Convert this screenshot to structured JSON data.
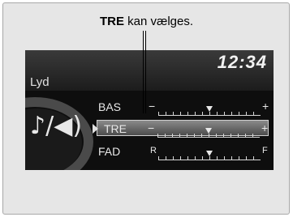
{
  "callout": {
    "bold": "TRE",
    "rest": " kan vælges."
  },
  "screen": {
    "clock": "12:34",
    "title": "Lyd",
    "icon": "audio-icon"
  },
  "rows": [
    {
      "label": "BAS",
      "left": "−",
      "right": "+",
      "level": 0.5
    },
    {
      "label": "TRE",
      "left": "−",
      "right": "+",
      "level": 0.5,
      "selected": true
    },
    {
      "label": "FAD",
      "left": "R",
      "right": "F",
      "level": 0.5
    }
  ]
}
